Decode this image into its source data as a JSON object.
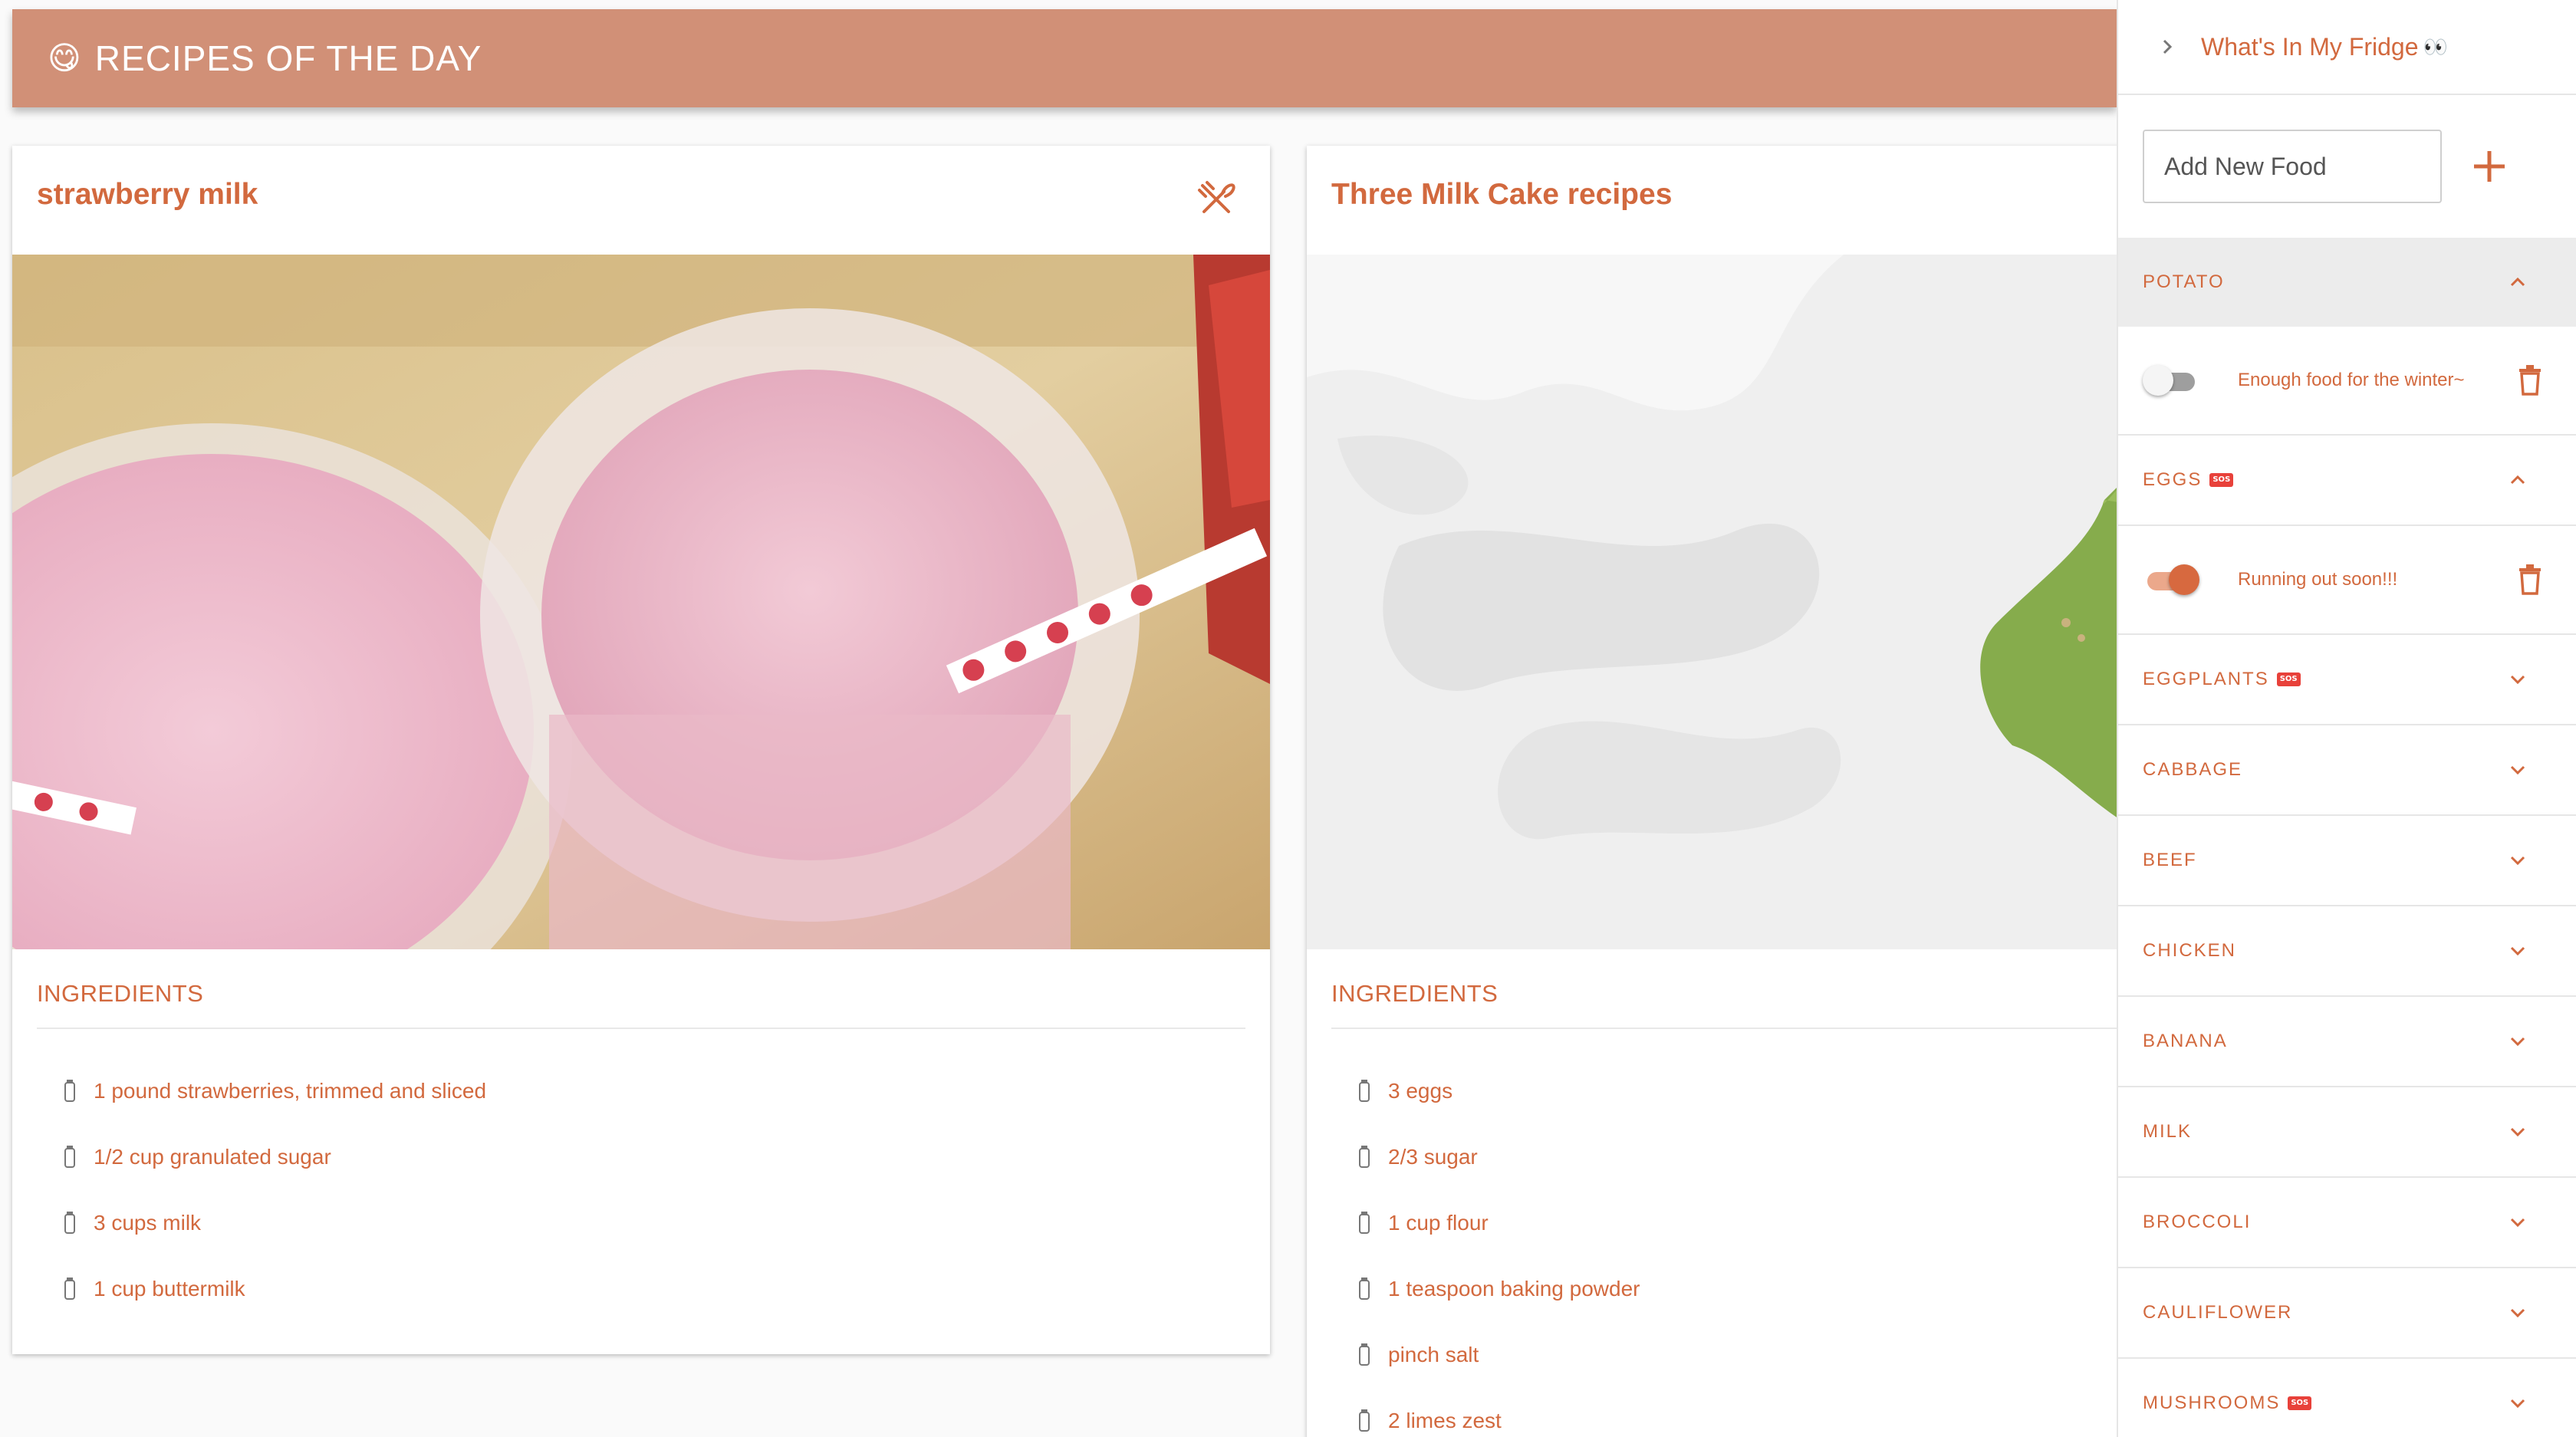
{
  "header": {
    "emoji": "😋",
    "title": "RECIPES OF THE DAY"
  },
  "cards": [
    {
      "title": "strawberry milk",
      "action_icon": "utensils-crossed-icon",
      "section_label": "INGREDIENTS",
      "ingredients": [
        "1 pound strawberries, trimmed and sliced",
        "1/2 cup granulated sugar",
        "3 cups milk",
        "1 cup buttermilk"
      ]
    },
    {
      "title": "Three Milk Cake recipes",
      "section_label": "INGREDIENTS",
      "ingredients": [
        "3 eggs",
        "2/3 sugar",
        "1 cup flour",
        "1 teaspoon baking powder",
        "pinch salt",
        "2 limes zest"
      ]
    }
  ],
  "sidebar": {
    "title": "What's In My Fridge",
    "title_emoji": "👀",
    "add_placeholder": "Add New Food",
    "foods": [
      {
        "name": "POTATO",
        "sos": false,
        "expanded": true,
        "toggle_on": false,
        "note": "Enough food for the winter~"
      },
      {
        "name": "EGGS",
        "sos": true,
        "expanded": true,
        "toggle_on": true,
        "note": "Running out soon!!!"
      },
      {
        "name": "EGGPLANTS",
        "sos": true,
        "expanded": false
      },
      {
        "name": "CABBAGE",
        "sos": false,
        "expanded": false
      },
      {
        "name": "BEEF",
        "sos": false,
        "expanded": false
      },
      {
        "name": "CHICKEN",
        "sos": false,
        "expanded": false
      },
      {
        "name": "BANANA",
        "sos": false,
        "expanded": false
      },
      {
        "name": "MILK",
        "sos": false,
        "expanded": false
      },
      {
        "name": "BROCCOLI",
        "sos": false,
        "expanded": false
      },
      {
        "name": "CAULIFLOWER",
        "sos": false,
        "expanded": false
      },
      {
        "name": "MUSHROOMS",
        "sos": true,
        "expanded": false
      }
    ],
    "sos_label": "SOS"
  },
  "colors": {
    "accent": "#d2693e",
    "header_bg": "#d19077",
    "sos": "#e8413a"
  }
}
